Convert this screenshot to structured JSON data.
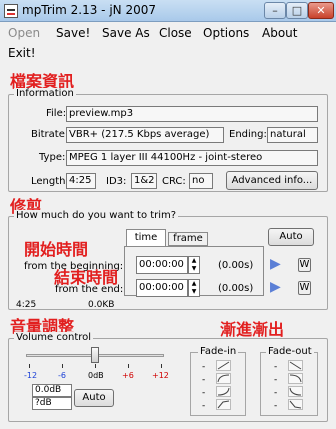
{
  "window": {
    "title": "mpTrim 2.13 - jN 2007"
  },
  "menu": {
    "open": "Open",
    "save": "Save!",
    "save_as": "Save As",
    "close": "Close",
    "options": "Options",
    "about": "About",
    "exit": "Exit!"
  },
  "annotations": {
    "file_info": "檔案資訊",
    "trim": "修剪",
    "start_time": "開始時間",
    "end_time": "結束時間",
    "volume_adjust": "音量調整",
    "fade": "漸進漸出"
  },
  "information": {
    "legend": "Information",
    "file_label": "File:",
    "file_value": "preview.mp3",
    "bitrate_label": "Bitrate:",
    "bitrate_value": "VBR+ (217.5 Kbps average)",
    "ending_label": "Ending:",
    "ending_value": "natural",
    "type_label": "Type:",
    "type_value": "MPEG 1 layer III 44100Hz - joint-stereo",
    "length_label": "Length:",
    "length_value": "4:25",
    "id3_label": "ID3:",
    "id3_value": "1&2",
    "crc_label": "CRC:",
    "crc_value": "no",
    "advanced_button": "Advanced info..."
  },
  "trim": {
    "legend": "How much do you want to trim?",
    "tab_time": "time",
    "tab_frame": "frame",
    "auto_button": "Auto",
    "beginning_label": "from the beginning:",
    "beginning_value": "00:00:00",
    "beginning_seconds": "(0.00s)",
    "end_label": "from the end:",
    "end_value": "00:00:00",
    "end_seconds": "(0.00s)",
    "w_label": "W",
    "length_display": "4:25",
    "size_display": "0.0KB"
  },
  "volume": {
    "legend": "Volume control",
    "ticks": [
      "-12",
      "-6",
      "0dB",
      "+6",
      "+12"
    ],
    "slider_level_db": 0,
    "value_db_top": "0.0dB",
    "value_db_bottom": "?dB",
    "auto_button": "Auto"
  },
  "fade": {
    "fade_in_label": "Fade-in",
    "fade_out_label": "Fade-out",
    "option_marker": "-"
  },
  "colors": {
    "annotation_red": "#e21f1f",
    "tick_red": "#d00000",
    "play_blue": "#5b7fd6"
  }
}
